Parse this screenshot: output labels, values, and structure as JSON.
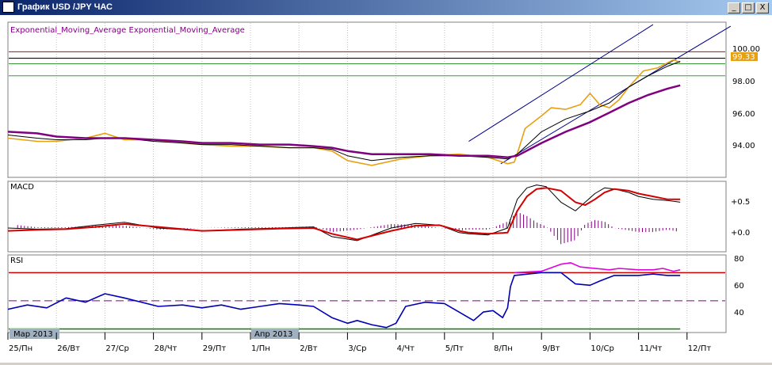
{
  "window": {
    "title": "График USD /JPY  ЧАС",
    "minimize_label": "_",
    "restore_label": "□",
    "close_label": "X"
  },
  "chart_data": [
    {
      "type": "line",
      "panel": "price",
      "legend": "Exponential_Moving_Average Exponential_Moving_Average",
      "y_ticks": [
        "100.00",
        "98.00",
        "96.00",
        "94.00"
      ],
      "ylim": [
        92.2,
        101.8
      ],
      "current_price_label": "99.33",
      "horizontal_levels": [
        {
          "value": 100.0,
          "color": "#d40000"
        },
        {
          "value": 99.6,
          "color": "#000000"
        },
        {
          "value": 99.25,
          "color": "#3a9a3a"
        },
        {
          "value": 98.5,
          "color": "#3a9a3a"
        }
      ],
      "series": [
        {
          "color": "#e8a010",
          "x": [
            0,
            3,
            5,
            8,
            10,
            12,
            15,
            18,
            20,
            23,
            26,
            29,
            31.5,
            33.4,
            35,
            37.5,
            40.5,
            43.5,
            46.5,
            49.5,
            51.5,
            52.2,
            52.7,
            53.3,
            55,
            56,
            57.5,
            59,
            60,
            61,
            62,
            63,
            64,
            65.5,
            67,
            68.6,
            69.3
          ],
          "values": [
            94.6,
            94.4,
            94.4,
            94.6,
            94.9,
            94.5,
            94.5,
            94.3,
            94.2,
            94.1,
            94.1,
            94.0,
            94.0,
            93.8,
            93.2,
            92.9,
            93.3,
            93.5,
            93.6,
            93.4,
            93.0,
            93.1,
            94.0,
            95.2,
            96.0,
            96.5,
            96.4,
            96.7,
            97.4,
            96.7,
            96.5,
            97.0,
            97.8,
            98.8,
            99.0,
            99.5,
            99.33
          ]
        },
        {
          "color": "#000000",
          "x": [
            0,
            3,
            5,
            8,
            10,
            12,
            15,
            18,
            20,
            23,
            26,
            29,
            31.5,
            33.4,
            35,
            37.5,
            40.5,
            43.5,
            46.5,
            49.5,
            51.5,
            52.5,
            55,
            57.5,
            60,
            62,
            64,
            66,
            68,
            69.3
          ],
          "values": [
            94.8,
            94.6,
            94.5,
            94.5,
            94.6,
            94.6,
            94.4,
            94.3,
            94.2,
            94.2,
            94.1,
            94.0,
            94.0,
            93.9,
            93.5,
            93.2,
            93.4,
            93.5,
            93.5,
            93.4,
            93.3,
            93.6,
            95.0,
            95.8,
            96.3,
            96.8,
            97.8,
            98.5,
            99.1,
            99.4
          ]
        },
        {
          "color": "#800080",
          "x": [
            0,
            3,
            5,
            8,
            10,
            12,
            15,
            18,
            20,
            23,
            26,
            29,
            31.5,
            33.4,
            35,
            37.5,
            40.5,
            43.5,
            46.5,
            49.5,
            51.5,
            52.5,
            55,
            57.5,
            60,
            62,
            64,
            66,
            68,
            69.3
          ],
          "values": [
            95.0,
            94.9,
            94.7,
            94.6,
            94.6,
            94.6,
            94.5,
            94.4,
            94.3,
            94.3,
            94.2,
            94.2,
            94.1,
            94.0,
            93.8,
            93.6,
            93.6,
            93.6,
            93.5,
            93.5,
            93.4,
            93.5,
            94.3,
            95.0,
            95.6,
            96.2,
            96.8,
            97.3,
            97.7,
            97.9
          ]
        }
      ],
      "channel_lines": [
        {
          "color": "#00008b",
          "x": [
            47.5,
            66.5
          ],
          "values": [
            94.4,
            101.7
          ]
        },
        {
          "color": "#00008b",
          "x": [
            50.8,
            74.5
          ],
          "values": [
            93.0,
            101.6
          ]
        }
      ]
    },
    {
      "type": "line",
      "panel": "macd",
      "legend": "MACD",
      "y_ticks": [
        "+0.5",
        "+0.0"
      ],
      "ylim": [
        -0.4,
        0.8
      ],
      "series": [
        {
          "color": "#000000",
          "x": [
            0,
            3,
            6,
            9,
            12,
            15.5,
            20,
            24,
            28,
            31.5,
            33.4,
            36,
            39.5,
            42,
            44.5,
            46.5,
            47.5,
            49.5,
            51.5,
            52.5,
            53.5,
            54.5,
            55.5,
            57,
            58.5,
            59.5,
            60.5,
            61.5,
            62.5,
            64,
            65,
            66.5,
            68,
            69.3
          ],
          "values": [
            0.0,
            -0.02,
            -0.01,
            0.05,
            0.1,
            0.0,
            -0.05,
            -0.02,
            0.0,
            0.02,
            -0.15,
            -0.22,
            0.0,
            0.08,
            0.05,
            -0.08,
            -0.1,
            -0.12,
            0.0,
            0.5,
            0.7,
            0.75,
            0.72,
            0.45,
            0.3,
            0.45,
            0.6,
            0.7,
            0.68,
            0.62,
            0.55,
            0.5,
            0.48,
            0.45
          ]
        },
        {
          "color": "#d40000",
          "x": [
            0,
            3,
            6,
            9,
            12,
            15.5,
            20,
            24,
            28,
            31.5,
            33.4,
            36,
            39.5,
            42,
            44.5,
            46.5,
            47.5,
            49.5,
            51.5,
            52.5,
            53.5,
            54.5,
            55.5,
            57,
            58.5,
            59.5,
            60.5,
            61.5,
            62.5,
            64,
            65,
            66.5,
            68,
            69.3
          ],
          "values": [
            -0.05,
            -0.03,
            -0.02,
            0.02,
            0.07,
            0.02,
            -0.05,
            -0.03,
            -0.01,
            0.0,
            -0.1,
            -0.2,
            -0.05,
            0.04,
            0.05,
            -0.05,
            -0.08,
            -0.1,
            -0.08,
            0.3,
            0.55,
            0.68,
            0.7,
            0.65,
            0.45,
            0.4,
            0.5,
            0.62,
            0.68,
            0.65,
            0.6,
            0.55,
            0.5,
            0.5
          ]
        }
      ]
    },
    {
      "type": "line",
      "panel": "rsi",
      "legend": "RSI",
      "y_ticks": [
        "80",
        "60",
        "40"
      ],
      "ylim": [
        28,
        82
      ],
      "levels": [
        {
          "value": 70,
          "color": "#d40000"
        },
        {
          "value": 50,
          "color": "#800080"
        },
        {
          "value": 30,
          "color": "#008000"
        }
      ],
      "series": [
        {
          "color": "#0000b4",
          "x": [
            0,
            2,
            4,
            6,
            8,
            10,
            12,
            15.5,
            18,
            20,
            22,
            24,
            26,
            28,
            30,
            31.5,
            33.4,
            35,
            36,
            37.5,
            39,
            40,
            41,
            43,
            45,
            47,
            48,
            49,
            50,
            51,
            51.5,
            51.8,
            52.2,
            55,
            57,
            58.5,
            60,
            61,
            62.5,
            65,
            66.5,
            68,
            69.3
          ],
          "values": [
            44,
            47,
            45,
            52,
            49,
            55,
            52,
            46,
            47,
            45,
            47,
            44,
            46,
            48,
            47,
            46,
            38,
            34,
            36,
            33,
            31,
            34,
            46,
            49,
            48,
            40,
            36,
            42,
            43,
            38,
            45,
            60,
            68,
            70,
            70,
            62,
            61,
            64,
            68,
            68,
            69,
            68,
            68
          ]
        },
        {
          "color": "#e000e0",
          "x": [
            52.2,
            55,
            57,
            58,
            59,
            62,
            63,
            65,
            66.5,
            67.5,
            68.6,
            69.3
          ],
          "values": [
            70,
            71,
            76,
            77,
            74,
            72,
            73,
            72,
            72,
            73,
            71,
            72
          ]
        }
      ]
    }
  ],
  "x_axis_labels": [
    "25/Пн",
    "26/Вт",
    "27/Ср",
    "28/Чт",
    "29/Пт",
    "1/Пн",
    "2/Вт",
    "3/Ср",
    "4/Чт",
    "5/Пт",
    "8/Пн",
    "9/Вт",
    "10/Ср",
    "11/Чт",
    "12/Пт"
  ],
  "period_markers": [
    "Мар 2013",
    "Апр 2013"
  ],
  "colors": {
    "background": "#ffffff",
    "title_bar": "#0a246a",
    "grid": "#c0c0c0",
    "price": "#e8a010",
    "fast_ema": "#000000",
    "slow_ema": "#800080",
    "channel": "#00008b",
    "macd_signal": "#d40000",
    "macd_histogram": "#800080",
    "rsi": "#0000b4",
    "rsi_overbought": "#e000e0"
  }
}
